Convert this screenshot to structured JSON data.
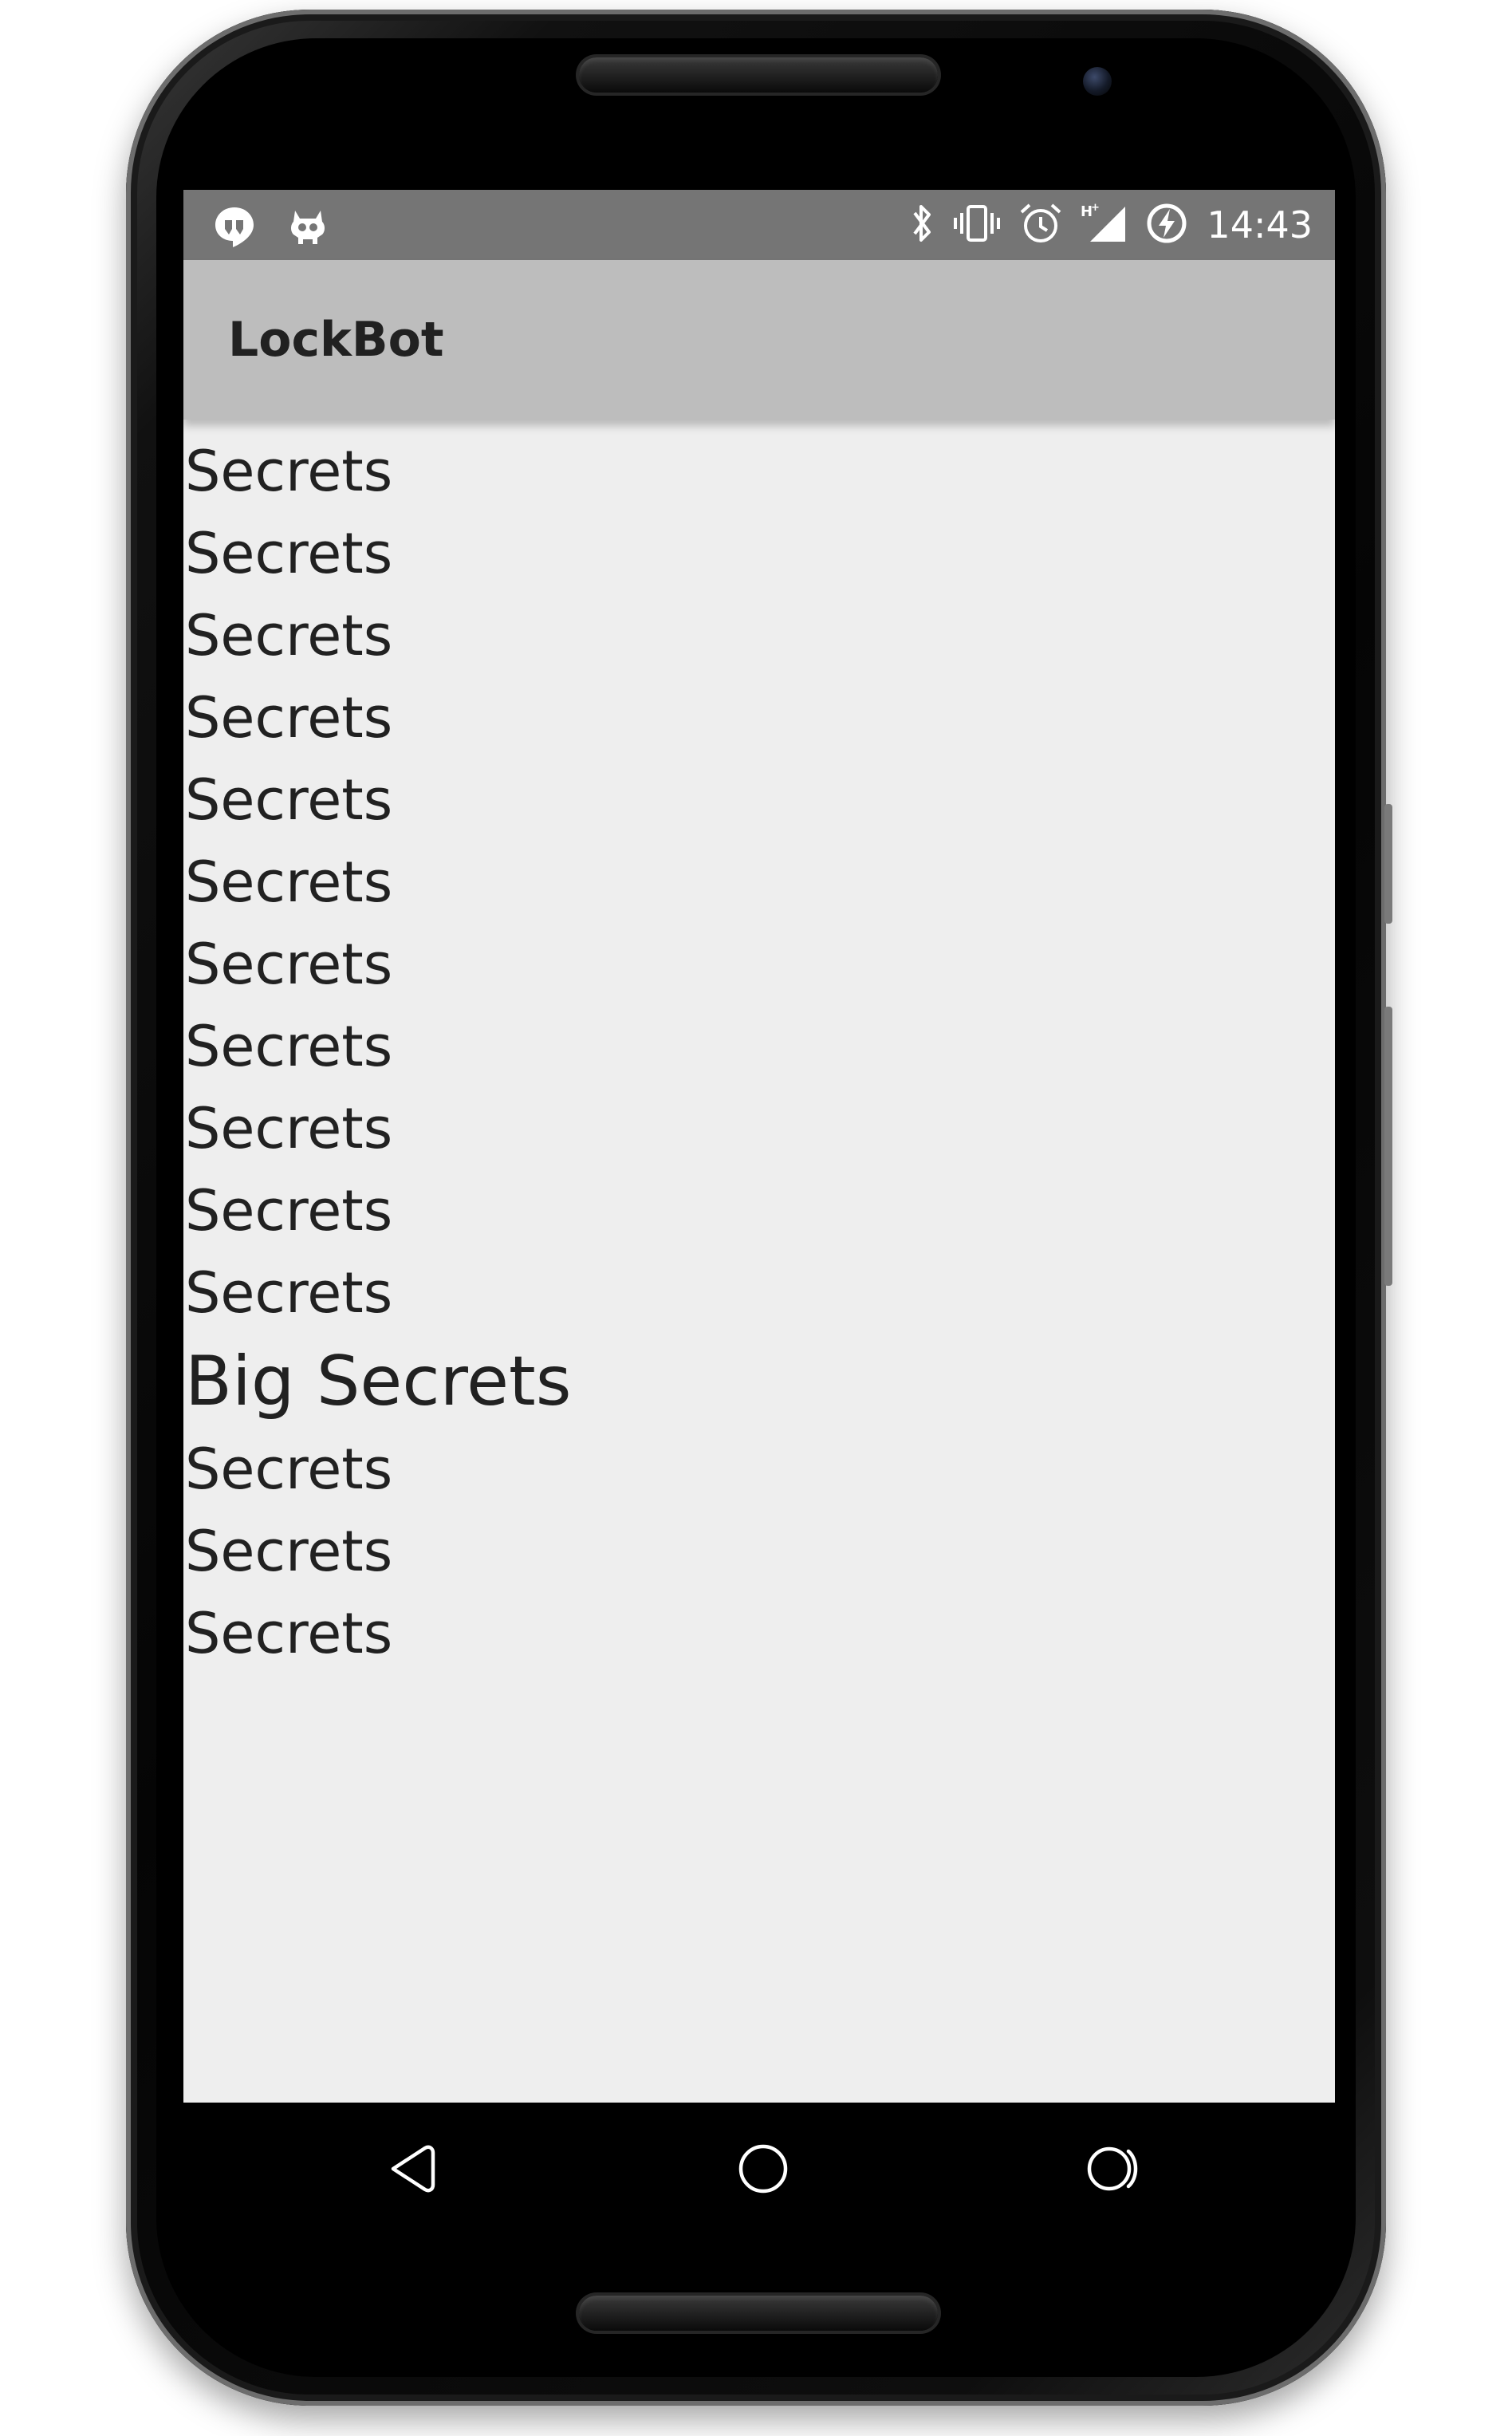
{
  "status_bar": {
    "time": "14:43",
    "left_icons": [
      "hangouts-icon",
      "cyanogenmod-icon"
    ],
    "right_icons": [
      "bluetooth-icon",
      "vibrate-icon",
      "alarm-icon",
      "signal-hplus-icon",
      "battery-charging-icon"
    ]
  },
  "app_bar": {
    "title": "LockBot"
  },
  "list": {
    "items": [
      {
        "text": "Secrets",
        "big": false
      },
      {
        "text": "Secrets",
        "big": false
      },
      {
        "text": "Secrets",
        "big": false
      },
      {
        "text": "Secrets",
        "big": false
      },
      {
        "text": "Secrets",
        "big": false
      },
      {
        "text": "Secrets",
        "big": false
      },
      {
        "text": "Secrets",
        "big": false
      },
      {
        "text": "Secrets",
        "big": false
      },
      {
        "text": "Secrets",
        "big": false
      },
      {
        "text": "Secrets",
        "big": false
      },
      {
        "text": "Secrets",
        "big": false
      },
      {
        "text": "Big Secrets",
        "big": true
      },
      {
        "text": "Secrets",
        "big": false
      },
      {
        "text": "Secrets",
        "big": false
      },
      {
        "text": "Secrets",
        "big": false
      }
    ]
  },
  "nav_bar": {
    "buttons": [
      "back-icon",
      "home-icon",
      "recents-icon"
    ]
  },
  "colors": {
    "status_bar": "#757575",
    "app_bar": "#bdbdbd",
    "content_bg": "#eeeeee",
    "text": "#212121"
  }
}
